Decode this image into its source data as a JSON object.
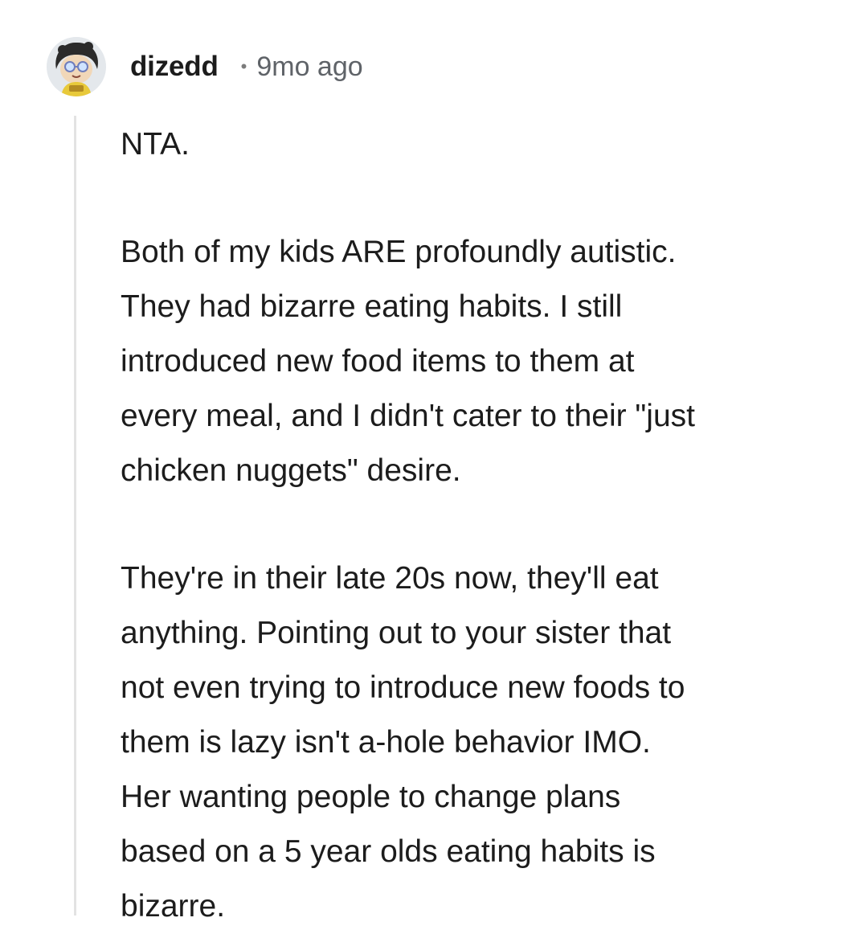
{
  "comment": {
    "author": "dizedd",
    "separator": "•",
    "time_ago": "9mo ago",
    "avatar_icon": "cartoon-character-avatar-icon",
    "paragraphs": [
      "NTA.",
      "Both of my kids ARE profoundly autistic.\nThey had bizarre eating habits. I still\nintroduced new food items to them at\nevery meal, and I didn't cater to their \"just\nchicken nuggets\" desire.",
      "They're in their late 20s now, they'll eat\nanything. Pointing out to your sister that\nnot even trying to introduce new foods to\nthem is lazy isn't a-hole behavior IMO.\nHer wanting people to change plans\nbased on a 5 year olds eating habits is\nbizarre."
    ]
  },
  "colors": {
    "text": "#1c1c1c",
    "meta": "#5f6368",
    "thread_line": "#e3e3e3",
    "background": "#ffffff"
  }
}
